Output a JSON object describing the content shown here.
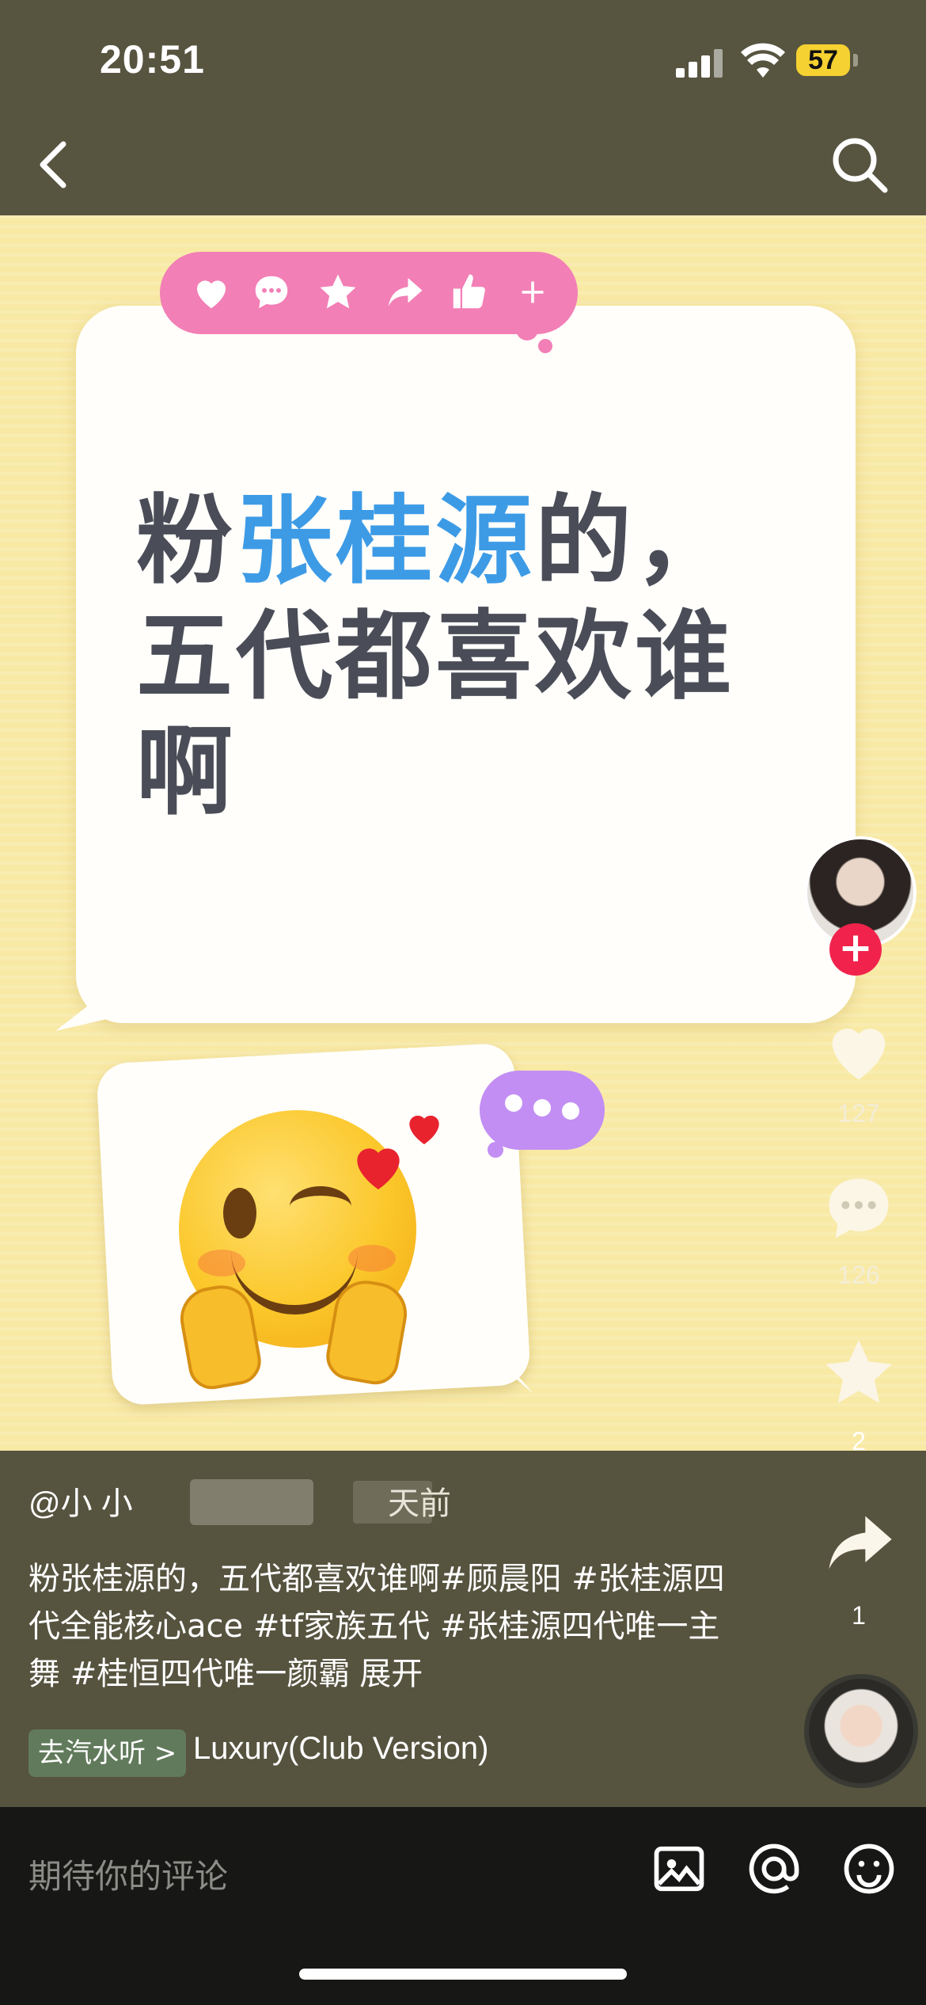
{
  "status_bar": {
    "time": "20:51",
    "battery": "57"
  },
  "nav": {
    "back_icon": "chevron-left-icon",
    "search_icon": "search-icon"
  },
  "video": {
    "toolbar_icons": [
      "heart-icon",
      "comment-icon",
      "star-icon",
      "share-icon",
      "thumbs-up-icon",
      "plus-icon"
    ],
    "headline_lines": [
      {
        "prefix": "粉",
        "highlight": "张桂源",
        "suffix": "的，"
      },
      {
        "prefix": "五代都喜欢谁",
        "highlight": "",
        "suffix": ""
      },
      {
        "prefix": "啊",
        "highlight": "",
        "suffix": ""
      }
    ],
    "emoji": "winking-face-with-hearts"
  },
  "right_rail": {
    "like_count": "127",
    "comment_count": "126",
    "favorite_count": "2",
    "share_count": "1"
  },
  "caption": {
    "author": "@小 小",
    "time_suffix": "天前",
    "description": "粉张桂源的，五代都喜欢谁啊#顾晨阳 #张桂源四代全能核心ace #tf家族五代 #张桂源四代唯一主舞 #桂恒四代唯一颜霸",
    "expand": "展开",
    "music_tag": "去汽水听 >",
    "music_title": "Luxury(Club Version)"
  },
  "comment_bar": {
    "placeholder": "期待你的评论"
  },
  "colors": {
    "highlight_blue": "#3d9be6",
    "follow_red": "#f1234c",
    "pink": "#f27fb6",
    "purple": "#c28ef3"
  }
}
